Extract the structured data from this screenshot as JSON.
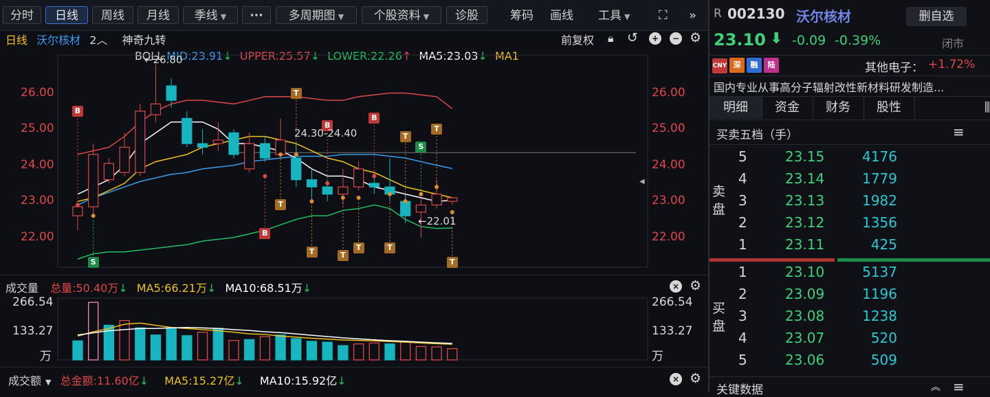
{
  "toolbar": {
    "tabs": [
      "分时",
      "日线",
      "周线",
      "月线"
    ],
    "season_dropdown": "季线",
    "more_label": "···",
    "multi_period": "多周期图",
    "stock_info": "个股资料",
    "diagnose": "诊股",
    "chips": "筹码",
    "draw": "画线",
    "tools": "工具"
  },
  "chart_header": {
    "period": "日线",
    "stock_name": "沃尔核材",
    "count": "2",
    "indicator": "神奇九转",
    "restore": "前复权"
  },
  "boll": {
    "label": "BOLL",
    "mid": "MID:23.91",
    "upper": "UPPER:25.57",
    "lower": "LOWER:22.26",
    "ma5": "MA5:23.03",
    "ma1": "MA1",
    "colors": {
      "mid": "#3a9cf0",
      "upper": "#e04848",
      "lower": "#21c062",
      "ma5": "#ffffff",
      "ma1": "#f0c020"
    }
  },
  "price_annotations": {
    "high": "26.80",
    "low": "22.01",
    "range": "24.30-24.40"
  },
  "volume_section": {
    "title": "成交量",
    "total": "总量:50.40万",
    "ma5": "MA5:66.21万",
    "ma10": "MA10:68.51万",
    "unit": "万"
  },
  "amount_section": {
    "title": "成交额",
    "total": "总金额:11.60亿",
    "ma5": "MA5:15.27亿",
    "ma10": "MA10:15.92亿"
  },
  "chart_data": [
    {
      "type": "candlestick",
      "y_ticks": [
        "26.00",
        "25.00",
        "24.00",
        "23.00",
        "22.00"
      ],
      "ylim": [
        21.1,
        27.0
      ],
      "candles": [
        {
          "o": 22.6,
          "c": 22.85,
          "h": 23.0,
          "l": 22.2
        },
        {
          "o": 22.85,
          "c": 24.3,
          "h": 24.6,
          "l": 22.6
        },
        {
          "o": 23.6,
          "c": 24.05,
          "h": 24.2,
          "l": 23.5
        },
        {
          "o": 23.8,
          "c": 24.5,
          "h": 24.9,
          "l": 23.7
        },
        {
          "o": 23.8,
          "c": 25.5,
          "h": 25.7,
          "l": 23.7
        },
        {
          "o": 25.4,
          "c": 25.7,
          "h": 26.8,
          "l": 25.2
        },
        {
          "o": 26.2,
          "c": 25.8,
          "h": 26.4,
          "l": 25.6
        },
        {
          "o": 25.3,
          "c": 24.6,
          "h": 25.5,
          "l": 24.5
        },
        {
          "o": 24.6,
          "c": 24.5,
          "h": 25.0,
          "l": 24.3
        },
        {
          "o": 24.6,
          "c": 24.7,
          "h": 25.2,
          "l": 24.4
        },
        {
          "o": 24.9,
          "c": 24.3,
          "h": 25.0,
          "l": 24.2
        },
        {
          "o": 23.9,
          "c": 24.6,
          "h": 24.9,
          "l": 23.8
        },
        {
          "o": 24.6,
          "c": 24.2,
          "h": 24.8,
          "l": 24.1
        },
        {
          "o": 24.3,
          "c": 24.7,
          "h": 25.3,
          "l": 24.2
        },
        {
          "o": 24.2,
          "c": 23.6,
          "h": 24.6,
          "l": 23.4
        },
        {
          "o": 23.6,
          "c": 23.4,
          "h": 23.9,
          "l": 23.0
        },
        {
          "o": 23.4,
          "c": 23.2,
          "h": 23.6,
          "l": 23.0
        },
        {
          "o": 23.2,
          "c": 23.4,
          "h": 23.9,
          "l": 22.9
        },
        {
          "o": 23.4,
          "c": 23.9,
          "h": 24.1,
          "l": 23.3
        },
        {
          "o": 23.5,
          "c": 23.4,
          "h": 23.7,
          "l": 23.2
        },
        {
          "o": 23.4,
          "c": 23.2,
          "h": 24.2,
          "l": 23.0
        },
        {
          "o": 23.0,
          "c": 22.6,
          "h": 23.2,
          "l": 22.4
        },
        {
          "o": 22.7,
          "c": 22.9,
          "h": 23.1,
          "l": 22.0
        },
        {
          "o": 22.9,
          "c": 23.2,
          "h": 23.6,
          "l": 22.8
        },
        {
          "o": 23.0,
          "c": 23.1,
          "h": 23.1,
          "l": 22.9
        }
      ],
      "upper": [
        24.3,
        24.4,
        24.5,
        24.8,
        25.2,
        25.5,
        25.7,
        25.8,
        25.8,
        25.75,
        25.7,
        25.8,
        25.9,
        25.9,
        25.9,
        25.85,
        25.8,
        25.8,
        25.9,
        25.95,
        26.0,
        26.0,
        25.95,
        25.9,
        25.57
      ],
      "mid": [
        22.9,
        23.1,
        23.25,
        23.4,
        23.55,
        23.65,
        23.75,
        23.8,
        23.9,
        23.95,
        24.0,
        24.1,
        24.15,
        24.2,
        24.25,
        24.25,
        24.25,
        24.3,
        24.3,
        24.3,
        24.25,
        24.2,
        24.1,
        24.0,
        23.91
      ],
      "lower": [
        21.4,
        21.55,
        21.6,
        21.6,
        21.65,
        21.7,
        21.75,
        21.8,
        21.9,
        21.95,
        22.0,
        22.1,
        22.2,
        22.35,
        22.5,
        22.6,
        22.6,
        22.75,
        22.8,
        22.9,
        22.8,
        22.5,
        22.3,
        22.25,
        22.26
      ],
      "ma5": [
        23.2,
        23.4,
        23.6,
        24.0,
        24.6,
        24.9,
        25.2,
        25.2,
        25.2,
        25.0,
        24.6,
        24.6,
        24.5,
        24.4,
        24.2,
        23.9,
        23.7,
        23.7,
        23.6,
        23.4,
        23.3,
        23.2,
        23.1,
        23.0,
        23.03
      ],
      "ma1": [
        23.0,
        23.1,
        23.3,
        23.5,
        23.9,
        24.1,
        24.2,
        24.3,
        24.5,
        24.6,
        24.7,
        24.8,
        24.8,
        24.7,
        24.6,
        24.4,
        24.2,
        24.1,
        23.9,
        23.8,
        23.6,
        23.4,
        23.3,
        23.2,
        23.1
      ]
    },
    {
      "type": "bar",
      "y_ticks": [
        "266.54",
        "133.27"
      ],
      "ylim": [
        0,
        266.54
      ],
      "values": [
        88,
        266,
        160,
        182,
        148,
        115,
        148,
        112,
        128,
        146,
        90,
        94,
        108,
        115,
        98,
        86,
        82,
        66,
        74,
        78,
        74,
        82,
        62,
        60,
        52
      ],
      "down": [
        false,
        true,
        false,
        true,
        false,
        false,
        false,
        false,
        true,
        false,
        true,
        false,
        true,
        false,
        false,
        false,
        false,
        false,
        true,
        true,
        false,
        true,
        true,
        true,
        true
      ],
      "ma5": [
        110,
        130,
        145,
        165,
        170,
        160,
        150,
        145,
        140,
        135,
        128,
        120,
        118,
        110,
        105,
        100,
        96,
        92,
        90,
        88,
        85,
        82,
        78,
        75,
        72
      ],
      "ma10": [
        115,
        125,
        135,
        140,
        145,
        145,
        148,
        150,
        148,
        145,
        140,
        136,
        130,
        126,
        120,
        114,
        108,
        102,
        97,
        93,
        89,
        86,
        82,
        79,
        76
      ]
    }
  ],
  "quote": {
    "flag": "R",
    "code": "002130",
    "name": "沃尔核材",
    "add_button": "删自选",
    "price": "23.10",
    "change": "-0.09",
    "change_pct": "-0.39%",
    "status": "闭市",
    "tags": [
      "CNY",
      "深",
      "融",
      "陆"
    ],
    "sector": "其他电子：",
    "sector_change": "+1.72%",
    "description": "国内专业从事高分子辐射改性新材料研发制造..."
  },
  "panel_tabs": [
    "明细",
    "资金",
    "财务",
    "股性"
  ],
  "orderbook": {
    "title": "买卖五档（手）",
    "sell_label": "卖盘",
    "buy_label": "买盘",
    "sell": [
      {
        "level": "5",
        "price": "23.15",
        "vol": "4176"
      },
      {
        "level": "4",
        "price": "23.14",
        "vol": "1779"
      },
      {
        "level": "3",
        "price": "23.13",
        "vol": "1982"
      },
      {
        "level": "2",
        "price": "23.12",
        "vol": "1356"
      },
      {
        "level": "1",
        "price": "23.11",
        "vol": "425"
      }
    ],
    "buy": [
      {
        "level": "1",
        "price": "23.10",
        "vol": "5137"
      },
      {
        "level": "2",
        "price": "23.09",
        "vol": "1196"
      },
      {
        "level": "3",
        "price": "23.08",
        "vol": "1238"
      },
      {
        "level": "4",
        "price": "23.07",
        "vol": "520"
      },
      {
        "level": "5",
        "price": "23.06",
        "vol": "509"
      }
    ]
  },
  "key_data_title": "关键数据"
}
